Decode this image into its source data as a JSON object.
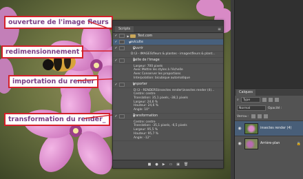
{
  "callouts": {
    "c1": "ouverture de l'image fleurs",
    "c2": "redimensionnement",
    "c3": "importation du render",
    "c4": "transformation du render_"
  },
  "scripts_panel": {
    "tab": "Scripts",
    "rows": {
      "set": "Test.com",
      "action": "aviculte",
      "open": "Ouvrir",
      "open_detail": "D:\\3 - IMAGES\\fleurs & plantes - images\\fleurs & plant...",
      "resize": "Taille de l'image",
      "resize_detail": [
        "Largeur: 700 pixels",
        "Avec Mettre les styles à l'échelle",
        "Avec Conserver les proportions",
        "Interpolation: bicubique automatique"
      ],
      "import": "Importer",
      "import_detail": [
        "D:\\3 - RENDERS\\insectes render\\insectes render (4)...",
        "Centre: centre",
        "Translation: 35,1 pixels, -38,1 pixels",
        "Largeur: 24,6 %",
        "Hauteur: 24,6 %",
        "Angle: 10°"
      ],
      "transform": "Transformation",
      "transform_detail": [
        "Centre: centre",
        "Translation: -35,1 pixels, -6,5 pixels",
        "Largeur: 95,5 %",
        "Hauteur: 95,7 %",
        "Angle: -12°"
      ]
    }
  },
  "layers_panel": {
    "tab": "Calques",
    "filter": "Type",
    "blend_mode": "Normal",
    "opacity_label": "Opacité :",
    "lock_label": "Verrou :",
    "layers": [
      {
        "name": "insectes render (4)"
      },
      {
        "name": "Arrière-plan"
      }
    ]
  },
  "colors": {
    "callout_border": "#d4202a",
    "callout_text": "#7a3f86",
    "selected_row": "#47607d"
  }
}
